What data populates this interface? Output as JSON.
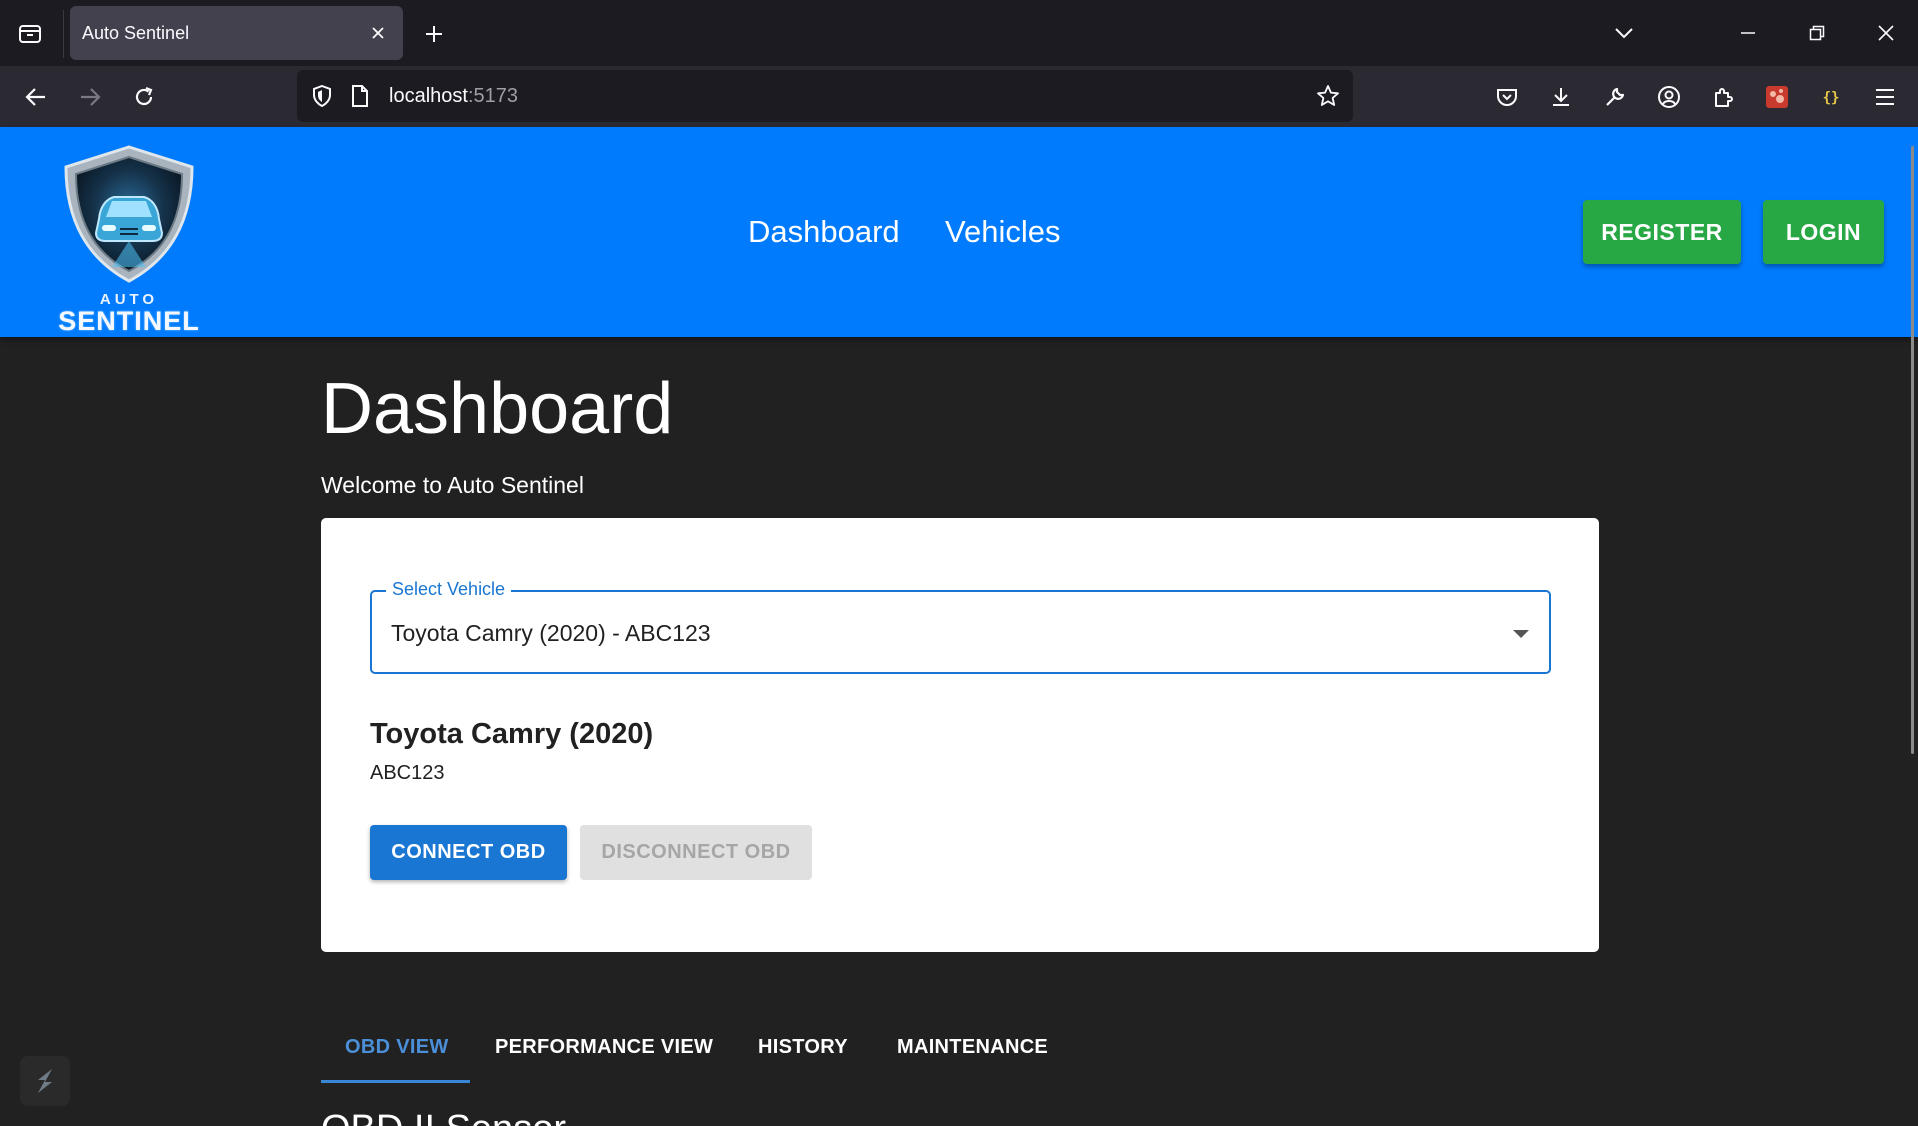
{
  "browser": {
    "tab_title": "Auto Sentinel",
    "url_host": "localhost",
    "url_port": ":5173"
  },
  "header": {
    "logo_top": "AUTO",
    "logo_bottom": "SENTINEL",
    "nav": [
      "Dashboard",
      "Vehicles"
    ],
    "register_label": "REGISTER",
    "login_label": "LOGIN",
    "accent_color": "#017bfe",
    "button_color": "#28a745"
  },
  "main": {
    "title": "Dashboard",
    "subtitle": "Welcome to Auto Sentinel",
    "select": {
      "label": "Select Vehicle",
      "value": "Toyota Camry (2020) - ABC123"
    },
    "vehicle": {
      "name": "Toyota Camry (2020)",
      "plate": "ABC123"
    },
    "connect_label": "CONNECT OBD",
    "disconnect_label": "DISCONNECT OBD",
    "tabs": [
      "OBD VIEW",
      "PERFORMANCE VIEW",
      "HISTORY",
      "MAINTENANCE"
    ],
    "active_tab": "OBD VIEW",
    "section_heading": "OBD II Sensor"
  }
}
